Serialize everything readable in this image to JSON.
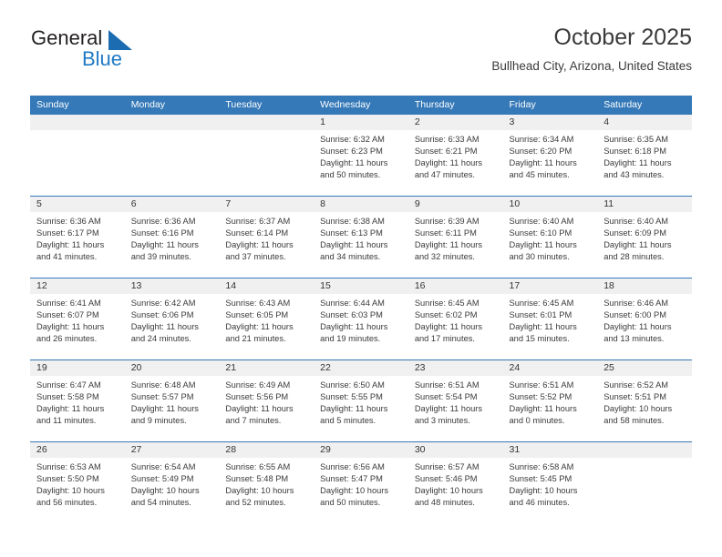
{
  "brand": {
    "word_one": "General",
    "word_two": "Blue",
    "triangle_icon": "triangle-icon",
    "accent_color": "#1b6cb0"
  },
  "header": {
    "month_title": "October 2025",
    "location": "Bullhead City, Arizona, United States"
  },
  "calendar": {
    "header_bg": "#3579b8",
    "daynum_bg": "#f0f0f0",
    "weekdays": [
      "Sunday",
      "Monday",
      "Tuesday",
      "Wednesday",
      "Thursday",
      "Friday",
      "Saturday"
    ],
    "weeks": [
      [
        {
          "day": "",
          "empty": true
        },
        {
          "day": "",
          "empty": true
        },
        {
          "day": "",
          "empty": true
        },
        {
          "day": "1",
          "sunrise": "Sunrise: 6:32 AM",
          "sunset": "Sunset: 6:23 PM",
          "daylight1": "Daylight: 11 hours",
          "daylight2": "and 50 minutes."
        },
        {
          "day": "2",
          "sunrise": "Sunrise: 6:33 AM",
          "sunset": "Sunset: 6:21 PM",
          "daylight1": "Daylight: 11 hours",
          "daylight2": "and 47 minutes."
        },
        {
          "day": "3",
          "sunrise": "Sunrise: 6:34 AM",
          "sunset": "Sunset: 6:20 PM",
          "daylight1": "Daylight: 11 hours",
          "daylight2": "and 45 minutes."
        },
        {
          "day": "4",
          "sunrise": "Sunrise: 6:35 AM",
          "sunset": "Sunset: 6:18 PM",
          "daylight1": "Daylight: 11 hours",
          "daylight2": "and 43 minutes."
        }
      ],
      [
        {
          "day": "5",
          "sunrise": "Sunrise: 6:36 AM",
          "sunset": "Sunset: 6:17 PM",
          "daylight1": "Daylight: 11 hours",
          "daylight2": "and 41 minutes."
        },
        {
          "day": "6",
          "sunrise": "Sunrise: 6:36 AM",
          "sunset": "Sunset: 6:16 PM",
          "daylight1": "Daylight: 11 hours",
          "daylight2": "and 39 minutes."
        },
        {
          "day": "7",
          "sunrise": "Sunrise: 6:37 AM",
          "sunset": "Sunset: 6:14 PM",
          "daylight1": "Daylight: 11 hours",
          "daylight2": "and 37 minutes."
        },
        {
          "day": "8",
          "sunrise": "Sunrise: 6:38 AM",
          "sunset": "Sunset: 6:13 PM",
          "daylight1": "Daylight: 11 hours",
          "daylight2": "and 34 minutes."
        },
        {
          "day": "9",
          "sunrise": "Sunrise: 6:39 AM",
          "sunset": "Sunset: 6:11 PM",
          "daylight1": "Daylight: 11 hours",
          "daylight2": "and 32 minutes."
        },
        {
          "day": "10",
          "sunrise": "Sunrise: 6:40 AM",
          "sunset": "Sunset: 6:10 PM",
          "daylight1": "Daylight: 11 hours",
          "daylight2": "and 30 minutes."
        },
        {
          "day": "11",
          "sunrise": "Sunrise: 6:40 AM",
          "sunset": "Sunset: 6:09 PM",
          "daylight1": "Daylight: 11 hours",
          "daylight2": "and 28 minutes."
        }
      ],
      [
        {
          "day": "12",
          "sunrise": "Sunrise: 6:41 AM",
          "sunset": "Sunset: 6:07 PM",
          "daylight1": "Daylight: 11 hours",
          "daylight2": "and 26 minutes."
        },
        {
          "day": "13",
          "sunrise": "Sunrise: 6:42 AM",
          "sunset": "Sunset: 6:06 PM",
          "daylight1": "Daylight: 11 hours",
          "daylight2": "and 24 minutes."
        },
        {
          "day": "14",
          "sunrise": "Sunrise: 6:43 AM",
          "sunset": "Sunset: 6:05 PM",
          "daylight1": "Daylight: 11 hours",
          "daylight2": "and 21 minutes."
        },
        {
          "day": "15",
          "sunrise": "Sunrise: 6:44 AM",
          "sunset": "Sunset: 6:03 PM",
          "daylight1": "Daylight: 11 hours",
          "daylight2": "and 19 minutes."
        },
        {
          "day": "16",
          "sunrise": "Sunrise: 6:45 AM",
          "sunset": "Sunset: 6:02 PM",
          "daylight1": "Daylight: 11 hours",
          "daylight2": "and 17 minutes."
        },
        {
          "day": "17",
          "sunrise": "Sunrise: 6:45 AM",
          "sunset": "Sunset: 6:01 PM",
          "daylight1": "Daylight: 11 hours",
          "daylight2": "and 15 minutes."
        },
        {
          "day": "18",
          "sunrise": "Sunrise: 6:46 AM",
          "sunset": "Sunset: 6:00 PM",
          "daylight1": "Daylight: 11 hours",
          "daylight2": "and 13 minutes."
        }
      ],
      [
        {
          "day": "19",
          "sunrise": "Sunrise: 6:47 AM",
          "sunset": "Sunset: 5:58 PM",
          "daylight1": "Daylight: 11 hours",
          "daylight2": "and 11 minutes."
        },
        {
          "day": "20",
          "sunrise": "Sunrise: 6:48 AM",
          "sunset": "Sunset: 5:57 PM",
          "daylight1": "Daylight: 11 hours",
          "daylight2": "and 9 minutes."
        },
        {
          "day": "21",
          "sunrise": "Sunrise: 6:49 AM",
          "sunset": "Sunset: 5:56 PM",
          "daylight1": "Daylight: 11 hours",
          "daylight2": "and 7 minutes."
        },
        {
          "day": "22",
          "sunrise": "Sunrise: 6:50 AM",
          "sunset": "Sunset: 5:55 PM",
          "daylight1": "Daylight: 11 hours",
          "daylight2": "and 5 minutes."
        },
        {
          "day": "23",
          "sunrise": "Sunrise: 6:51 AM",
          "sunset": "Sunset: 5:54 PM",
          "daylight1": "Daylight: 11 hours",
          "daylight2": "and 3 minutes."
        },
        {
          "day": "24",
          "sunrise": "Sunrise: 6:51 AM",
          "sunset": "Sunset: 5:52 PM",
          "daylight1": "Daylight: 11 hours",
          "daylight2": "and 0 minutes."
        },
        {
          "day": "25",
          "sunrise": "Sunrise: 6:52 AM",
          "sunset": "Sunset: 5:51 PM",
          "daylight1": "Daylight: 10 hours",
          "daylight2": "and 58 minutes."
        }
      ],
      [
        {
          "day": "26",
          "sunrise": "Sunrise: 6:53 AM",
          "sunset": "Sunset: 5:50 PM",
          "daylight1": "Daylight: 10 hours",
          "daylight2": "and 56 minutes."
        },
        {
          "day": "27",
          "sunrise": "Sunrise: 6:54 AM",
          "sunset": "Sunset: 5:49 PM",
          "daylight1": "Daylight: 10 hours",
          "daylight2": "and 54 minutes."
        },
        {
          "day": "28",
          "sunrise": "Sunrise: 6:55 AM",
          "sunset": "Sunset: 5:48 PM",
          "daylight1": "Daylight: 10 hours",
          "daylight2": "and 52 minutes."
        },
        {
          "day": "29",
          "sunrise": "Sunrise: 6:56 AM",
          "sunset": "Sunset: 5:47 PM",
          "daylight1": "Daylight: 10 hours",
          "daylight2": "and 50 minutes."
        },
        {
          "day": "30",
          "sunrise": "Sunrise: 6:57 AM",
          "sunset": "Sunset: 5:46 PM",
          "daylight1": "Daylight: 10 hours",
          "daylight2": "and 48 minutes."
        },
        {
          "day": "31",
          "sunrise": "Sunrise: 6:58 AM",
          "sunset": "Sunset: 5:45 PM",
          "daylight1": "Daylight: 10 hours",
          "daylight2": "and 46 minutes."
        },
        {
          "day": "",
          "empty": true
        }
      ]
    ]
  }
}
